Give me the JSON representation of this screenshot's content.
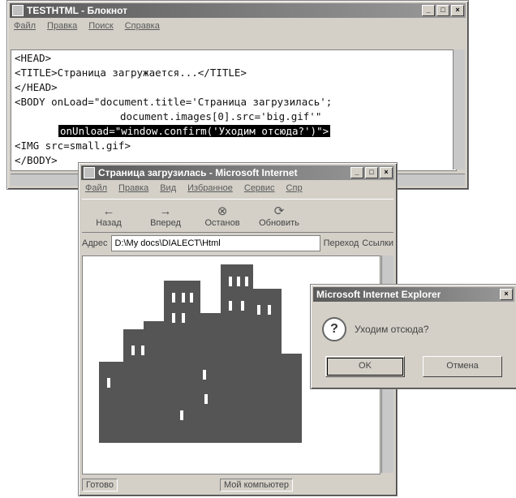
{
  "notepad": {
    "title": "TESTHTML - Блокнот",
    "menu": [
      "Файл",
      "Правка",
      "Поиск",
      "Справка"
    ],
    "code": {
      "l1": "<HEAD>",
      "l2": "<TITLE>Страница загружается...</TITLE>",
      "l3": "</HEAD>",
      "l4": "<BODY onLoad=\"document.title='Страница загрузилась';",
      "l5": "document.images[0].src='big.gif'\"",
      "l6": "onUnload=\"window.confirm('Уходим отсюда?')\">",
      "l7": "<IMG src=small.gif>",
      "l8": "</BODY>"
    }
  },
  "ie": {
    "title": "Страница загрузилась - Microsoft Internet",
    "menu": [
      "Файл",
      "Правка",
      "Вид",
      "Избранное",
      "Сервис",
      "Спр"
    ],
    "toolbar": {
      "back": "Назад",
      "forward": "Вперед",
      "stop": "Останов",
      "refresh": "Обновить"
    },
    "address_label": "Адрес",
    "address_value": "D:\\My docs\\DIALECT\\Html",
    "go_label": "Переход",
    "links_label": "Ссылки",
    "status_left": "Готово",
    "status_zone": "Мой компьютер"
  },
  "dialog": {
    "title": "Microsoft Internet Explorer",
    "message": "Уходим отсюда?",
    "ok": "OK",
    "cancel": "Отмена"
  }
}
